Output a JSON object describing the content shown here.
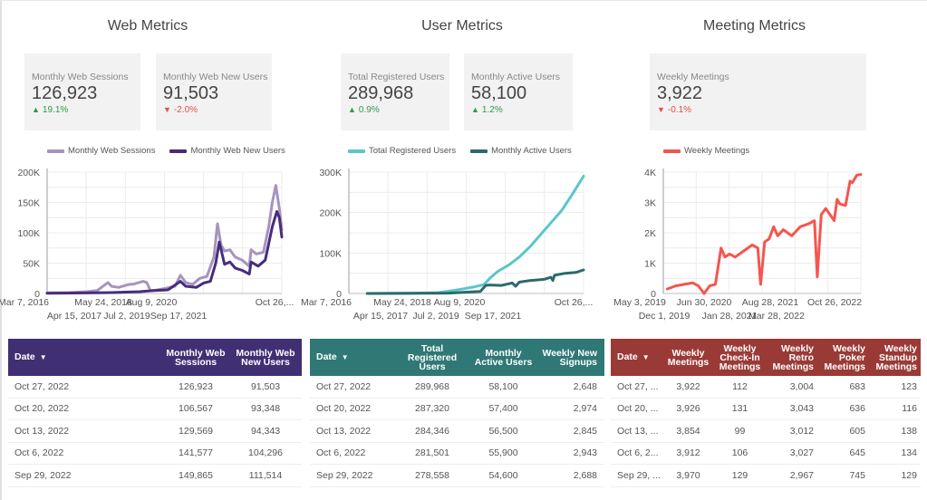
{
  "colors": {
    "web_sessions": "#a594c0",
    "web_new_users": "#472d7b",
    "registered": "#5cc6c8",
    "active": "#2b6a6c",
    "meetings": "#f6554f",
    "web_header": "#412f73",
    "user_header": "#2f7876",
    "meeting_header": "#9a3a36",
    "up": "#2e9a44",
    "down": "#e84b4b"
  },
  "sections": [
    {
      "title": "Web Metrics",
      "kpis": [
        {
          "label": "Monthly Web Sessions",
          "value": "126,923",
          "delta": "19.1%",
          "direction": "up",
          "arrow": "🠅"
        },
        {
          "label": "Monthly Web New Users",
          "value": "91,503",
          "delta": "-2.0%",
          "direction": "down",
          "arrow": "🠇"
        }
      ],
      "legend": [
        "Monthly Web Sessions",
        "Monthly Web New Users"
      ],
      "table": {
        "headers": [
          "Date",
          "Monthly Web Sessions",
          "Monthly Web New Users"
        ],
        "sort_indicator": "▼",
        "rows": [
          [
            "Oct 27, 2022",
            "126,923",
            "91,503"
          ],
          [
            "Oct 20, 2022",
            "106,567",
            "93,348"
          ],
          [
            "Oct 13, 2022",
            "129,569",
            "94,343"
          ],
          [
            "Oct 6, 2022",
            "141,577",
            "104,296"
          ],
          [
            "Sep 29, 2022",
            "149,865",
            "111,514"
          ]
        ]
      }
    },
    {
      "title": "User Metrics",
      "kpis": [
        {
          "label": "Total Registered Users",
          "value": "289,968",
          "delta": "0.9%",
          "direction": "up",
          "arrow": "🠅"
        },
        {
          "label": "Monthly Active Users",
          "value": "58,100",
          "delta": "1.2%",
          "direction": "up",
          "arrow": "🠅"
        }
      ],
      "legend": [
        "Total Registered Users",
        "Monthly Active Users"
      ],
      "table": {
        "headers": [
          "Date",
          "Total Registered Users",
          "Monthly Active Users",
          "Weekly New Signups"
        ],
        "sort_indicator": "▼",
        "rows": [
          [
            "Oct 27, 2022",
            "289,968",
            "58,100",
            "2,648"
          ],
          [
            "Oct 20, 2022",
            "287,320",
            "57,400",
            "2,974"
          ],
          [
            "Oct 13, 2022",
            "284,346",
            "56,500",
            "2,845"
          ],
          [
            "Oct 6, 2022",
            "281,501",
            "55,900",
            "2,943"
          ],
          [
            "Sep 29, 2022",
            "278,558",
            "54,600",
            "2,688"
          ]
        ]
      }
    },
    {
      "title": "Meeting Metrics",
      "kpis": [
        {
          "label": "Weekly Meetings",
          "value": "3,922",
          "delta": "-0.1%",
          "direction": "down",
          "arrow": "🠇"
        }
      ],
      "legend": [
        "Weekly Meetings"
      ],
      "table": {
        "headers": [
          "Date",
          "Weekly Meetings",
          "Weekly Check-In Meetings",
          "Weekly Retro Meetings",
          "Weekly Poker Meetings",
          "Weekly Standup Meetings"
        ],
        "sort_indicator": "▼",
        "rows": [
          [
            "Oct 27, ...",
            "3,922",
            "112",
            "3,004",
            "683",
            "123"
          ],
          [
            "Oct 20, ...",
            "3,926",
            "131",
            "3,043",
            "636",
            "116"
          ],
          [
            "Oct 13, ...",
            "3,854",
            "99",
            "3,012",
            "605",
            "138"
          ],
          [
            "Oct 6, 2...",
            "3,912",
            "106",
            "3,027",
            "645",
            "134"
          ],
          [
            "Sep 29, ...",
            "3,970",
            "129",
            "2,967",
            "745",
            "129"
          ]
        ]
      }
    }
  ],
  "chart_data": [
    {
      "type": "line",
      "title": "Web Metrics",
      "xlabel": "",
      "ylabel": "",
      "ylim": [
        0,
        200000
      ],
      "yticks": [
        "0",
        "50K",
        "100K",
        "150K",
        "200K"
      ],
      "xtick_labels_row1": [
        "Mar 7, 2016",
        "May 24, 2018",
        "Aug 9, 2020",
        "Oct 26,..."
      ],
      "xtick_labels_row2": [
        "Apr 15, 2017",
        "Jul 2, 2019",
        "Sep 17, 2021"
      ],
      "xlim_years": [
        2016.18,
        2022.82
      ],
      "grid": true,
      "legend_position": "top",
      "series": [
        {
          "name": "Monthly Web Sessions",
          "x": [
            2016.18,
            2016.8,
            2017.3,
            2017.6,
            2017.9,
            2018.0,
            2018.2,
            2018.5,
            2018.6,
            2018.9,
            2019.0,
            2019.1,
            2019.2,
            2019.5,
            2019.8,
            2019.95,
            2020.1,
            2020.3,
            2020.5,
            2020.7,
            2020.9,
            2021.0,
            2021.1,
            2021.2,
            2021.35,
            2021.5,
            2021.7,
            2021.9,
            2021.95,
            2022.1,
            2022.3,
            2022.45,
            2022.55,
            2022.65,
            2022.75,
            2022.82
          ],
          "values": [
            1000,
            1500,
            3000,
            5000,
            18000,
            12000,
            10000,
            15000,
            15000,
            20000,
            18000,
            5000,
            5000,
            8000,
            12000,
            30000,
            18000,
            15000,
            25000,
            28000,
            60000,
            115000,
            80000,
            70000,
            72000,
            60000,
            55000,
            45000,
            72000,
            65000,
            68000,
            110000,
            150000,
            178000,
            140000,
            105000
          ]
        },
        {
          "name": "Monthly Web New Users",
          "x": [
            2016.18,
            2017.0,
            2018.0,
            2018.8,
            2019.2,
            2019.6,
            2019.95,
            2020.1,
            2020.4,
            2020.6,
            2020.8,
            2020.95,
            2021.05,
            2021.2,
            2021.35,
            2021.5,
            2021.7,
            2021.9,
            2021.95,
            2022.15,
            2022.35,
            2022.55,
            2022.68,
            2022.75,
            2022.82
          ],
          "values": [
            500,
            800,
            1500,
            3000,
            5000,
            6000,
            20000,
            12000,
            10000,
            17000,
            20000,
            50000,
            85000,
            48000,
            52000,
            42000,
            38000,
            32000,
            52000,
            45000,
            55000,
            110000,
            135000,
            125000,
            93000
          ]
        }
      ]
    },
    {
      "type": "line",
      "title": "User Metrics",
      "xlabel": "",
      "ylabel": "",
      "ylim": [
        0,
        300000
      ],
      "yticks": [
        "0",
        "100K",
        "200K",
        "300K"
      ],
      "xtick_labels_row1": [
        "Mar 7, 2016",
        "May 24, 2018",
        "Aug 9, 2020",
        "Oct 26,..."
      ],
      "xtick_labels_row2": [
        "Apr 15, 2017",
        "Jul 2, 2019",
        "Sep 17, 2021"
      ],
      "xlim_years": [
        2016.18,
        2022.82
      ],
      "grid": true,
      "legend_position": "top",
      "series": [
        {
          "name": "Total Registered Users",
          "x": [
            2016.7,
            2018.0,
            2018.7,
            2019.2,
            2019.7,
            2020.0,
            2020.2,
            2020.4,
            2020.7,
            2021.0,
            2021.3,
            2021.6,
            2021.9,
            2022.2,
            2022.5,
            2022.82
          ],
          "values": [
            0,
            500,
            2000,
            8000,
            16000,
            22000,
            40000,
            55000,
            70000,
            90000,
            115000,
            145000,
            175000,
            205000,
            245000,
            289968
          ]
        },
        {
          "name": "Monthly Active Users",
          "x": [
            2016.7,
            2019.0,
            2019.9,
            2020.05,
            2020.15,
            2020.5,
            2020.8,
            2020.9,
            2021.0,
            2021.3,
            2021.7,
            2021.9,
            2021.95,
            2022.0,
            2022.3,
            2022.6,
            2022.82
          ],
          "values": [
            0,
            1000,
            5000,
            20000,
            21000,
            20000,
            26000,
            18000,
            28000,
            32000,
            35000,
            40000,
            32000,
            45000,
            50000,
            52000,
            58100
          ]
        }
      ]
    },
    {
      "type": "line",
      "title": "Meeting Metrics",
      "xlabel": "",
      "ylabel": "",
      "ylim": [
        0,
        4000
      ],
      "yticks": [
        "0",
        "1K",
        "2K",
        "3K",
        "4K"
      ],
      "xtick_labels_row1": [
        "May 3, 2019",
        "Jun 30, 2020",
        "Aug 28, 2021",
        "Oct 26, 2022"
      ],
      "xtick_labels_row2": [
        "Dec 1, 2019",
        "Jan 28, 2021",
        "Mar 28, 2022"
      ],
      "xlim_years": [
        2019.33,
        2022.82
      ],
      "grid": true,
      "legend_position": "top",
      "series": [
        {
          "name": "Weekly Meetings",
          "x": [
            2019.4,
            2019.55,
            2019.7,
            2019.85,
            2019.95,
            2020.05,
            2020.15,
            2020.25,
            2020.35,
            2020.42,
            2020.5,
            2020.6,
            2020.75,
            2020.9,
            2021.0,
            2021.05,
            2021.12,
            2021.2,
            2021.28,
            2021.35,
            2021.45,
            2021.6,
            2021.75,
            2021.9,
            2022.0,
            2022.05,
            2022.12,
            2022.2,
            2022.35,
            2022.4,
            2022.45,
            2022.55,
            2022.63,
            2022.67,
            2022.75,
            2022.82
          ],
          "values": [
            150,
            250,
            300,
            350,
            250,
            0,
            250,
            300,
            1500,
            1200,
            1300,
            1200,
            1400,
            1600,
            1500,
            300,
            1700,
            1800,
            2200,
            1900,
            2100,
            1900,
            2200,
            2300,
            2400,
            550,
            2600,
            2800,
            2400,
            3100,
            2950,
            2900,
            3700,
            3650,
            3900,
            3922
          ]
        }
      ]
    }
  ]
}
